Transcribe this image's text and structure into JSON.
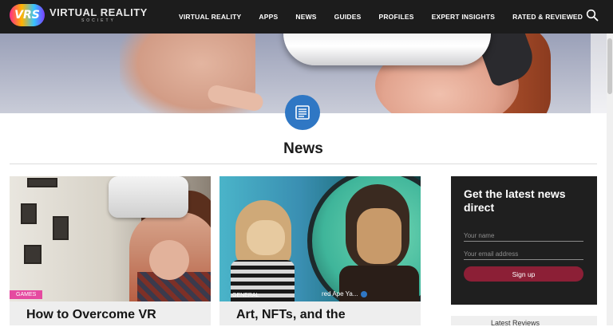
{
  "brand": {
    "badge": "VRS",
    "name": "VIRTUAL REALITY",
    "subname": "SOCIETY"
  },
  "nav": {
    "items": [
      {
        "label": "VIRTUAL REALITY"
      },
      {
        "label": "APPS"
      },
      {
        "label": "NEWS"
      },
      {
        "label": "GUIDES"
      },
      {
        "label": "PROFILES"
      },
      {
        "label": "EXPERT INSIGHTS"
      },
      {
        "label": "RATED & REVIEWED"
      }
    ],
    "search_icon": "search-icon"
  },
  "page": {
    "title": "News",
    "section_icon": "newspaper-icon"
  },
  "cards": [
    {
      "category": "GAMES",
      "title": "How to Overcome VR",
      "category_color": "#e54aa0"
    },
    {
      "category": "GENERAL",
      "title": "Art, NFTs, and the",
      "image_caption": "red Ape Ya..."
    }
  ],
  "signup": {
    "title": "Get the latest news direct",
    "name_placeholder": "Your name",
    "email_placeholder": "Your email address",
    "button_label": "Sign up",
    "button_color": "#8c1f36"
  },
  "sidebar": {
    "latest_label": "Latest Reviews"
  },
  "colors": {
    "nav_bg": "#1c1c1c",
    "accent_blue": "#2f77c4"
  }
}
